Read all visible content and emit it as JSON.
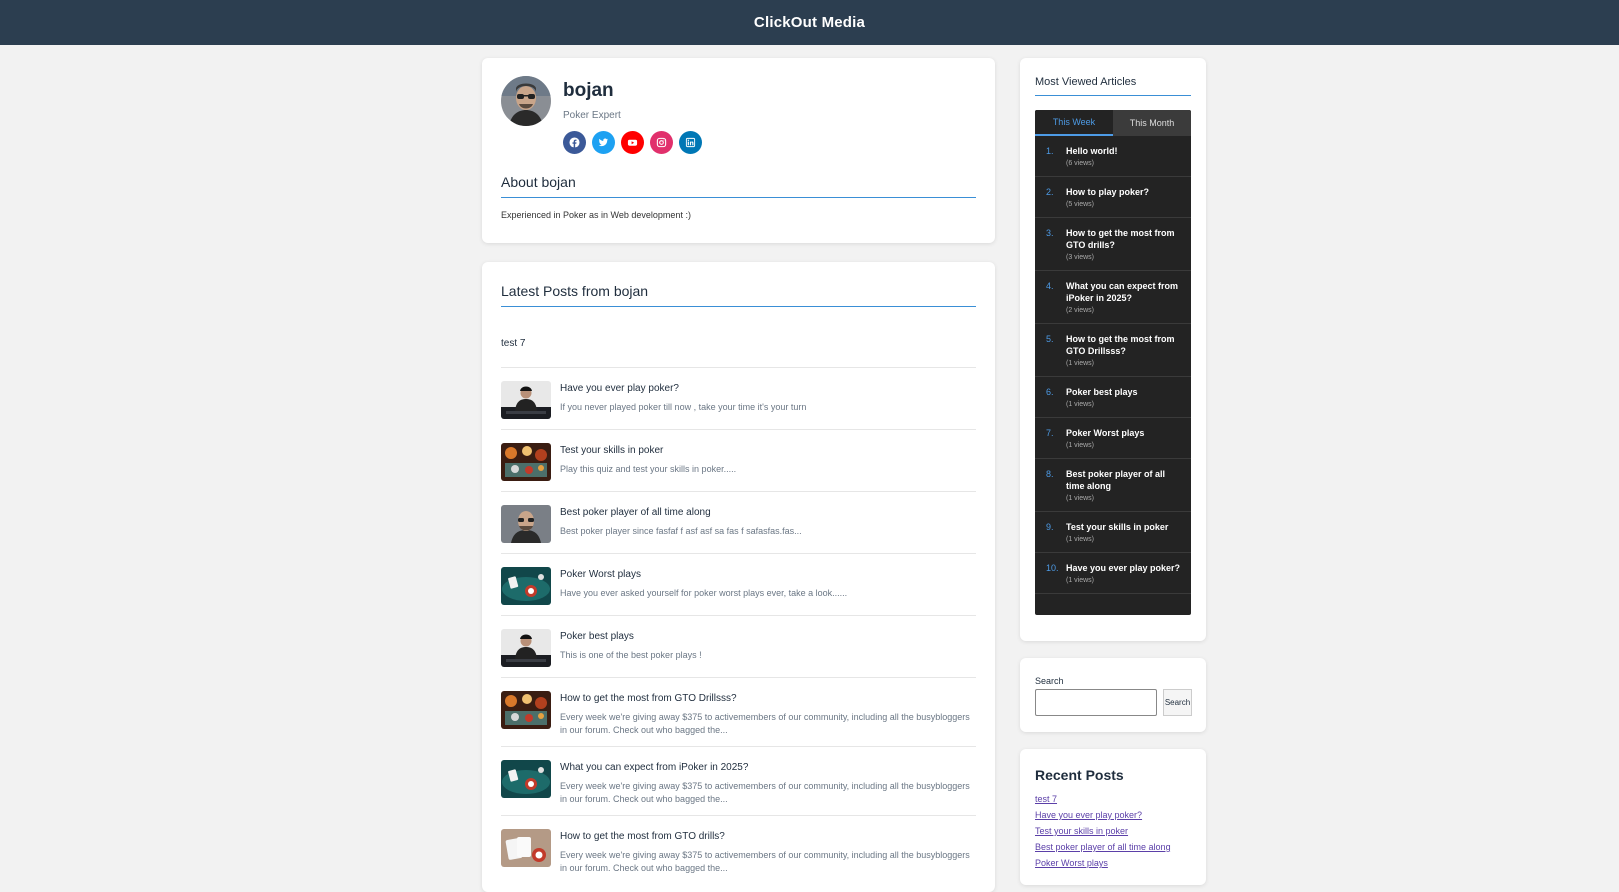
{
  "header": {
    "brand": "ClickOut Media"
  },
  "profile": {
    "name": "bojan",
    "role": "Poker Expert",
    "socials": [
      "facebook-icon",
      "twitter-icon",
      "youtube-icon",
      "instagram-icon",
      "linkedin-icon"
    ],
    "about_heading": "About bojan",
    "about_text": "Experienced in Poker as in Web development :)"
  },
  "latest": {
    "heading": "Latest Posts from bojan",
    "plain_post": "test 7",
    "posts": [
      {
        "title": "Have you ever play poker?",
        "excerpt": "If you never played poker till now , take your time it's your turn",
        "thumb": "poker-player"
      },
      {
        "title": "Test your skills in poker",
        "excerpt": "Play this quiz and test your skills in poker.....",
        "thumb": "poker-chips"
      },
      {
        "title": "Best poker player of all time along",
        "excerpt": "Best poker player since fasfaf f asf asf sa fas f safasfas.fas...",
        "thumb": "man-portrait"
      },
      {
        "title": "Poker Worst plays",
        "excerpt": "Have you ever asked yourself for poker worst plays ever, take a look......",
        "thumb": "poker-table"
      },
      {
        "title": "Poker best plays",
        "excerpt": "This is one of the best poker plays !",
        "thumb": "poker-player"
      },
      {
        "title": "How to get the most from GTO Drillsss?",
        "excerpt": "Every week we're giving away $375 to activemembers of our community, including all the busybloggers in our forum. Check out who bagged the...",
        "thumb": "poker-chips"
      },
      {
        "title": "What you can expect from iPoker in 2025?",
        "excerpt": "Every week we're giving away $375 to activemembers of our community, including all the busybloggers in our forum. Check out who bagged the...",
        "thumb": "poker-table"
      },
      {
        "title": "How to get the most from GTO drills?",
        "excerpt": "Every week we're giving away $375 to activemembers of our community, including all the busybloggers in our forum. Check out who bagged the...",
        "thumb": "poker-hand"
      }
    ]
  },
  "most_viewed": {
    "heading": "Most Viewed Articles",
    "tabs": [
      "This Week",
      "This Month"
    ],
    "items": [
      {
        "rank": "1.",
        "title": "Hello world!",
        "views": "(6 views)"
      },
      {
        "rank": "2.",
        "title": "How to play poker?",
        "views": "(5 views)"
      },
      {
        "rank": "3.",
        "title": "How to get the most from GTO drills?",
        "views": "(3 views)"
      },
      {
        "rank": "4.",
        "title": "What you can expect from iPoker in 2025?",
        "views": "(2 views)"
      },
      {
        "rank": "5.",
        "title": "How to get the most from GTO Drillsss?",
        "views": "(1 views)"
      },
      {
        "rank": "6.",
        "title": "Poker best plays",
        "views": "(1 views)"
      },
      {
        "rank": "7.",
        "title": "Poker Worst plays",
        "views": "(1 views)"
      },
      {
        "rank": "8.",
        "title": "Best poker player of all time along",
        "views": "(1 views)"
      },
      {
        "rank": "9.",
        "title": "Test your skills in poker",
        "views": "(1 views)"
      },
      {
        "rank": "10.",
        "title": "Have you ever play poker?",
        "views": "(1 views)"
      }
    ]
  },
  "search": {
    "label": "Search",
    "value": "",
    "button": "Search"
  },
  "recent": {
    "heading": "Recent Posts",
    "links": [
      "test 7",
      "Have you ever play poker?",
      "Test your skills in poker",
      "Best poker player of all time along",
      "Poker Worst plays"
    ]
  },
  "colors": {
    "header": "#2c3e50",
    "accent": "#3a8fd6",
    "facebook": "#3b5998",
    "twitter": "#1da1f2",
    "youtube": "#ff0000",
    "instagram": "#e1306c",
    "linkedin": "#0077b5"
  }
}
